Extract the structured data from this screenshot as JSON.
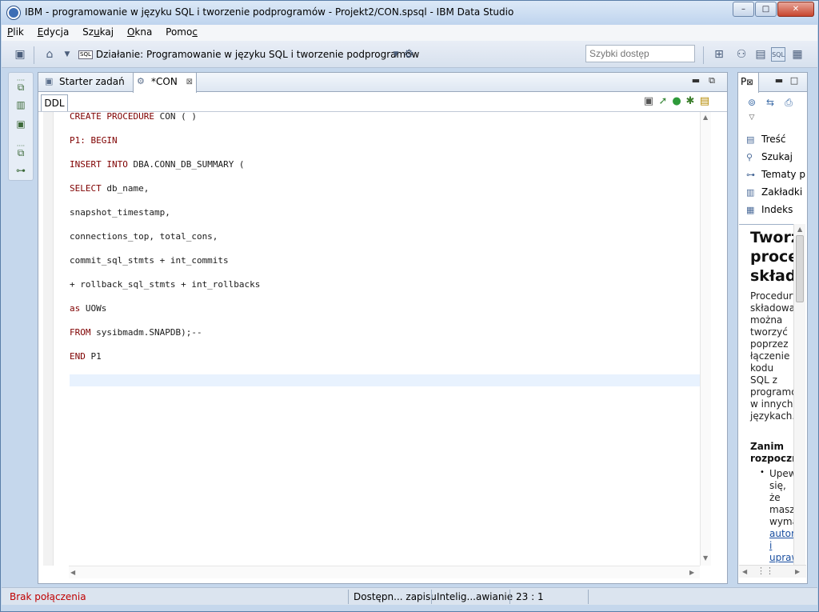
{
  "window": {
    "title": "IBM - programowanie w języku SQL i tworzenie podprogramów - Projekt2/CON.spsql - IBM Data Studio",
    "minimize_glyph": "–",
    "maximize_glyph": "□",
    "close_glyph": "✕"
  },
  "menu": {
    "items": [
      {
        "prefix": "",
        "underlined": "P",
        "rest": "lik"
      },
      {
        "prefix": "",
        "underlined": "E",
        "rest": "dycja"
      },
      {
        "prefix": "Sz",
        "underlined": "u",
        "rest": "kaj"
      },
      {
        "prefix": "",
        "underlined": "O",
        "rest": "kna"
      },
      {
        "prefix": "Pomo",
        "underlined": "c",
        "rest": ""
      }
    ]
  },
  "toolbar": {
    "sql_badge": "SQL",
    "activity_label": "Działanie: Programowanie w języku SQL i tworzenie podprogramów",
    "quick_access_placeholder": "Szybki dostęp"
  },
  "editor": {
    "tabs": [
      {
        "label": "Starter zadań",
        "active": false
      },
      {
        "label": "*CON",
        "active": true
      }
    ],
    "close_glyph": "⊠",
    "ddl_tab": "DDL",
    "code_lines": [
      {
        "kw": "CREATE PROCEDURE",
        "rest": " CON ( )"
      },
      {
        "kw": "P1: BEGIN",
        "rest": ""
      },
      {
        "kw": "INSERT INTO",
        "rest": " DBA.CONN_DB_SUMMARY ("
      },
      {
        "kw": "SELECT",
        "rest": " db_name,"
      },
      {
        "kw": "",
        "rest": "snapshot_timestamp,"
      },
      {
        "kw": "",
        "rest": "connections_top, total_cons,"
      },
      {
        "kw": "",
        "rest": "commit_sql_stmts + int_commits"
      },
      {
        "kw": "",
        "rest": "+ rollback_sql_stmts + int_rollbacks"
      },
      {
        "kw": "as",
        "rest": " UOWs"
      },
      {
        "kw": "FROM",
        "rest": " sysibmadm.SNAPDB);--"
      },
      {
        "kw": "END",
        "rest": " P1"
      }
    ]
  },
  "help_view": {
    "tab_label": "P",
    "items": [
      {
        "icon": "content-icon",
        "label": "Treść"
      },
      {
        "icon": "search-icon",
        "label": "Szukaj"
      },
      {
        "icon": "topics-icon",
        "label": "Tematy p"
      },
      {
        "icon": "bookmarks-icon",
        "label": "Zakładki"
      },
      {
        "icon": "index-icon",
        "label": "Indeks"
      }
    ],
    "title": "Tworzenie procedur składowanych",
    "body": "Procedury składowane można tworzyć poprzez łączenie kodu SQL z programowaniem w innych językach.",
    "subheading": "Zanim rozpoczniesz",
    "list_text": "Upewnij się, że masz wymagane",
    "list_link_1": "autoryzacje",
    "list_link_2": "i",
    "list_link_3": "uprawnienia"
  },
  "status": {
    "connection": "Brak połączenia",
    "connection_color": "#c00000",
    "write_mode": "Dostępn... zapisu",
    "insert_mode": "Intelig...awianie",
    "position": "23 : 1"
  }
}
